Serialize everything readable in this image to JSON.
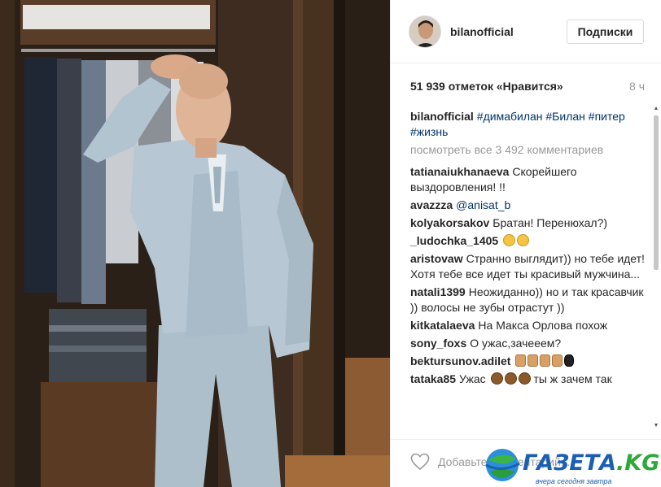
{
  "photo": {
    "description_icon": "photo-of-man-in-grey-suit"
  },
  "post": {
    "username": "bilanofficial",
    "follow_label": "Подписки",
    "likes": "51 939 отметок «Нравится»",
    "time": "8 ч"
  },
  "caption": {
    "user": "bilanofficial",
    "tags_line1": "#димабилан #Билан",
    "tags_line2": "#питер #жизнь"
  },
  "view_all": "посмотреть все 3 492 комментариев",
  "comments": [
    {
      "user": "tatianaiukhanaeva",
      "text": "Скорейшего выздоровления! !!"
    },
    {
      "user": "avazzza",
      "mention": "@anisat_b"
    },
    {
      "user": "kolyakorsakov",
      "text": "Братан! Перенюхал?)"
    },
    {
      "user": "_ludochka_1405",
      "emoji": "squinting-face-emoji"
    },
    {
      "user": "aristovaw",
      "text": "Странно выглядит)) но тебе идет! Хотя тебе все идет ты красивый мужчина..."
    },
    {
      "user": "natali1399",
      "text": "Неожиданно)) но и так красавчик )) волосы не зубы отрастут ))"
    },
    {
      "user": "kitkatalaeva",
      "text": "На Макса Орлова похож"
    },
    {
      "user": "sony_foxs",
      "text": "О ужас,зачееем?"
    },
    {
      "user": "bektursunov.adilet",
      "emoji": "thumbs-up-emoji"
    },
    {
      "user": "tataka85",
      "text_before": "Ужас",
      "text_after": "ты ж зачем так"
    }
  ],
  "input": {
    "placeholder": "Добавьте комментарий..."
  },
  "watermark": {
    "brand": "ГАЗЕТА",
    "tld": ".KG",
    "tagline": "вчера сегодня завтра"
  },
  "colors": {
    "link": "#003569",
    "muted": "#999999",
    "border": "#efefef",
    "brand_blue": "#1b5fb3",
    "brand_green": "#2fa83a"
  }
}
